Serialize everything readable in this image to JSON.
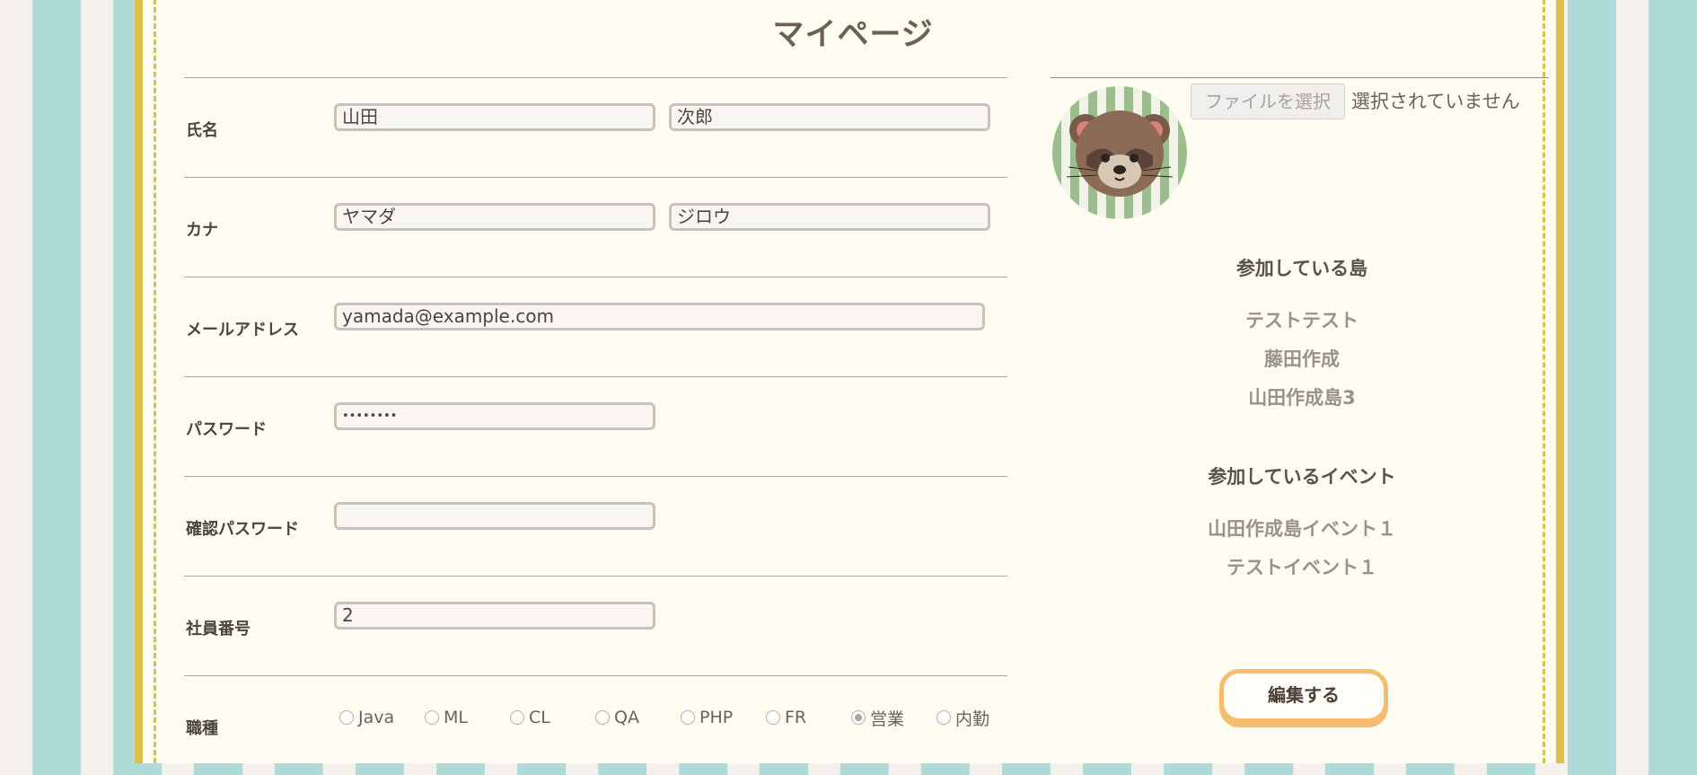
{
  "page": {
    "title": "マイページ"
  },
  "form": {
    "name": {
      "label": "氏名",
      "last": "山田",
      "first": "次郎"
    },
    "kana": {
      "label": "カナ",
      "last": "ヤマダ",
      "first": "ジロウ"
    },
    "email": {
      "label": "メールアドレス",
      "value": "yamada@example.com"
    },
    "password": {
      "label": "パスワード",
      "value": "••••••••"
    },
    "confirm_password": {
      "label": "確認パスワード",
      "value": ""
    },
    "employee_id": {
      "label": "社員番号",
      "value": "2"
    },
    "job": {
      "label": "職種",
      "options": [
        "Java",
        "ML",
        "CL",
        "QA",
        "PHP",
        "FR",
        "営業",
        "内勤"
      ],
      "selected": "営業"
    }
  },
  "profile": {
    "file_button": "ファイルを選択",
    "file_status": "選択されていません",
    "avatar_icon": "tanuki-avatar-icon"
  },
  "islands": {
    "heading": "参加している島",
    "items": [
      "テストテスト",
      "藤田作成",
      "山田作成島3"
    ]
  },
  "events": {
    "heading": "参加しているイベント",
    "items": [
      "山田作成島イベント１",
      "テストイベント１"
    ]
  },
  "actions": {
    "edit": "編集する"
  },
  "colors": {
    "background_teal": "#aedbd8",
    "frame_gold": "#dcc04c",
    "button_orange": "#f6bd6f"
  }
}
